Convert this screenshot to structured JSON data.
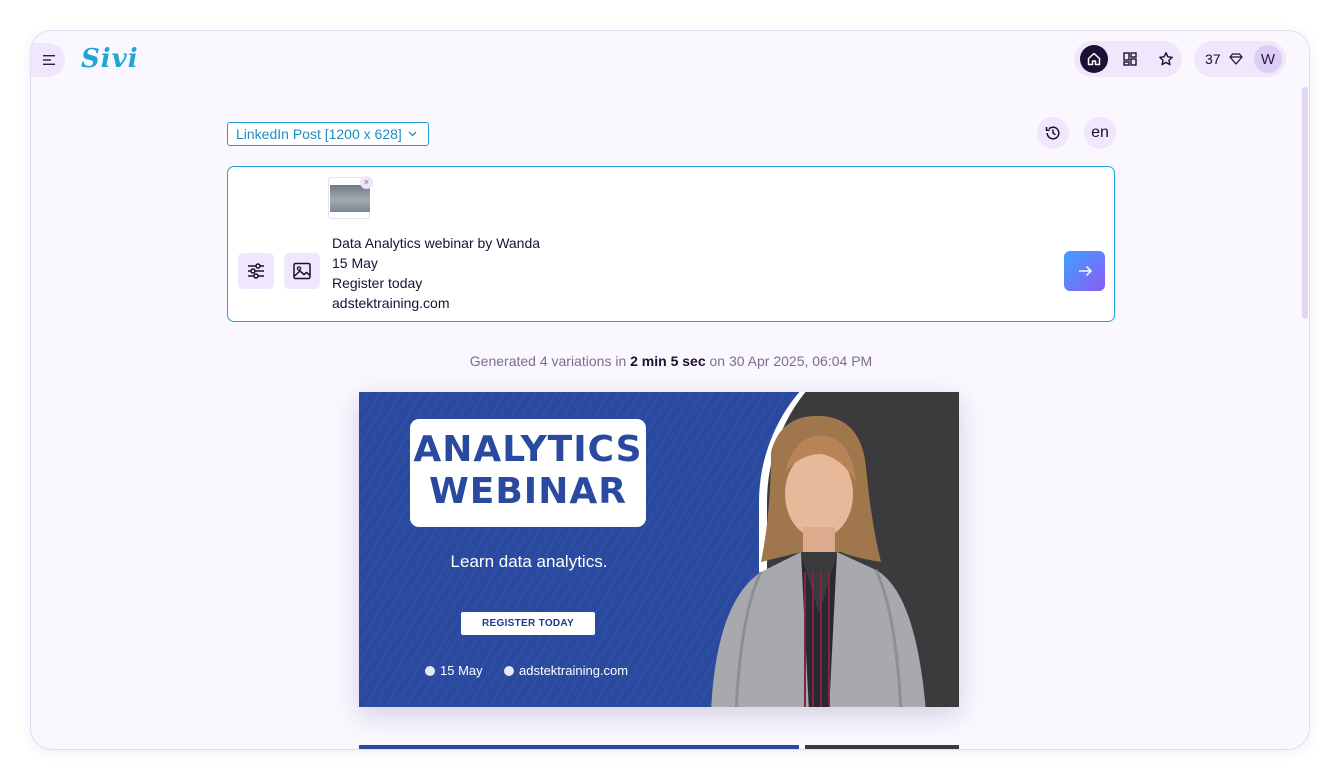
{
  "app": {
    "logo": "Sivi"
  },
  "header": {
    "menu_icon": "hamburger-menu-icon",
    "nav_icons": [
      "home-icon",
      "grid-icon",
      "star-icon"
    ],
    "credits": "37",
    "credits_icon": "diamond-icon",
    "avatar_initial": "W"
  },
  "toolbar": {
    "format_label": "LinkedIn Post [1200 x 628]",
    "history_icon": "history-icon",
    "language": "en"
  },
  "prompt": {
    "text": "Data Analytics webinar by Wanda\n15 May\nRegister today\nadstektraining.com",
    "attachment_remove": "×",
    "settings_icon": "sliders-icon",
    "image_icon": "image-icon",
    "send_icon": "arrow-right-icon"
  },
  "generation": {
    "prefix": "Generated 4 variations in",
    "duration": "2 min 5 sec",
    "suffix": "on 30 Apr 2025, 06:04 PM"
  },
  "design": {
    "title_line1": "ANALYTICS",
    "title_line2": "WEBINAR",
    "subtitle": "Learn data analytics.",
    "cta": "REGISTER TODAY",
    "date": "15 May",
    "website": "adstektraining.com",
    "colors": {
      "primary": "#2a4aa0",
      "dark": "#3b3b3d",
      "accent": "#1fa6d6"
    }
  }
}
